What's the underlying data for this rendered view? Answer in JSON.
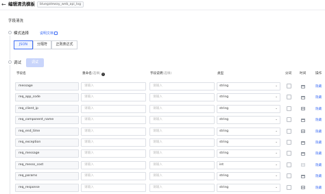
{
  "header": {
    "title": "编辑清洗模板",
    "breadcrumb_tag": "bluegateway_web_api_log",
    "back_icon": "arrow-left-icon"
  },
  "section": {
    "title": "字段清洗"
  },
  "steps": {
    "mode": {
      "label": "模式选择",
      "help_link": "说明文档"
    },
    "debug": {
      "label": "调试",
      "button": "调试"
    }
  },
  "mode_options": [
    {
      "label": "JSON",
      "selected": true
    },
    {
      "label": "分隔符",
      "selected": false
    },
    {
      "label": "正则表达式",
      "selected": false
    }
  ],
  "table": {
    "headers": {
      "field_name": "字段名",
      "rename": "重命名",
      "rename_hint": "(选填)",
      "desc": "字段说明",
      "desc_hint": "(选填)",
      "type": "类型",
      "tokenize": "分词",
      "time": "时间",
      "action": "操作"
    },
    "input_placeholder": "请输入",
    "action_label": "隐藏",
    "rows": [
      {
        "name": "message",
        "type": "string",
        "time_enabled": true
      },
      {
        "name": "req_app_code",
        "type": "string",
        "time_enabled": true
      },
      {
        "name": "req_client_ip",
        "type": "string",
        "time_enabled": true
      },
      {
        "name": "req_component_name",
        "type": "string",
        "time_enabled": true
      },
      {
        "name": "req_end_time",
        "type": "string",
        "time_enabled": true
      },
      {
        "name": "req_exception",
        "type": "string",
        "time_enabled": true
      },
      {
        "name": "req_message",
        "type": "string",
        "time_enabled": true
      },
      {
        "name": "req_messs_cost",
        "type": "int",
        "time_enabled": false
      },
      {
        "name": "req_params",
        "type": "string",
        "time_enabled": true
      },
      {
        "name": "req_response",
        "type": "string",
        "time_enabled": true
      }
    ]
  },
  "colors": {
    "accent": "#3f6ef5",
    "disabled_button": "#c9d5fb"
  }
}
